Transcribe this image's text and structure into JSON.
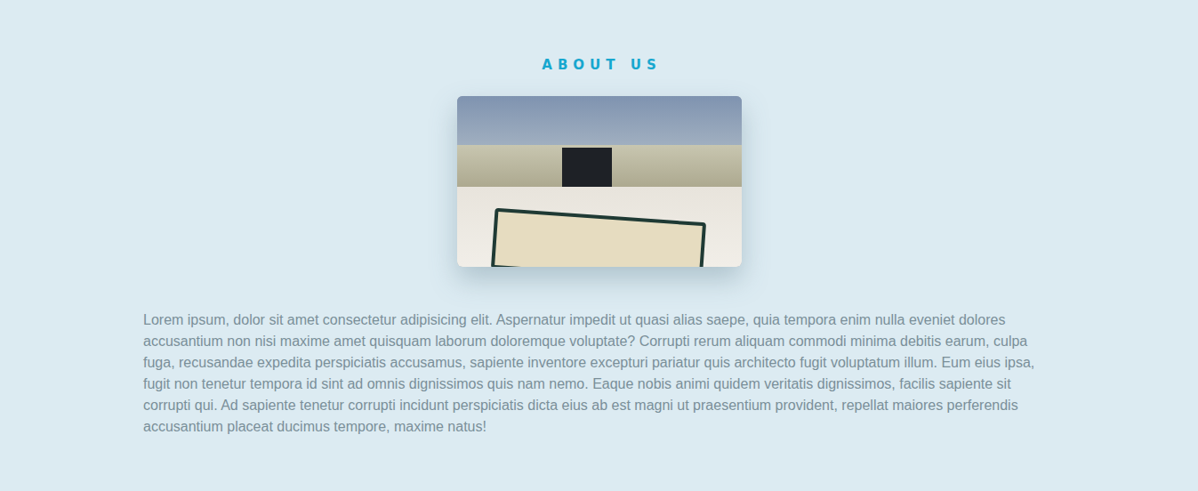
{
  "section": {
    "heading": "ABOUT US",
    "paragraph": "Lorem ipsum, dolor sit amet consectetur adipisicing elit. Aspernatur impedit ut quasi alias saepe, quia tempora enim nulla eveniet dolores accusantium non nisi maxime amet quisquam laborum doloremque voluptate? Corrupti rerum aliquam commodi minima debitis earum, culpa fuga, recusandae expedita perspiciatis accusamus, sapiente inventore excepturi pariatur quis architecto fugit voluptatum illum. Eum eius ipsa, fugit non tenetur tempora id sint ad omnis dignissimos quis nam nemo. Eaque nobis animi quidem veritatis dignissimos, facilis sapiente sit corrupti qui. Ad sapiente tenetur corrupti incidunt perspiciatis dicta eius ab est magni ut praesentium provident, repellat maiores perferendis accusantium placeat ducimus tempore, maxime natus!"
  }
}
